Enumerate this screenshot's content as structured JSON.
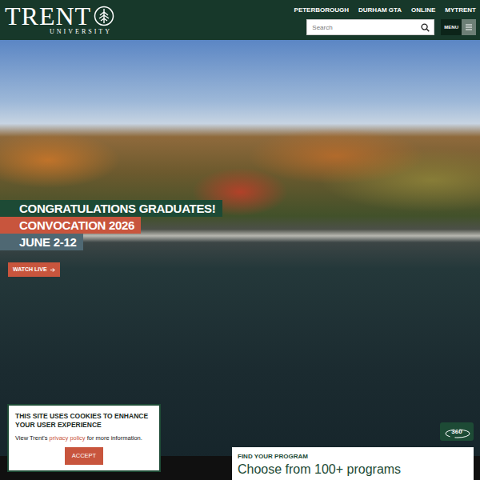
{
  "logo": {
    "name": "TRENT",
    "subtitle": "UNIVERSITY"
  },
  "top_links": [
    "PETERBOROUGH",
    "DURHAM GTA",
    "ONLINE",
    "MYTRENT"
  ],
  "search": {
    "placeholder": "Search"
  },
  "menu_button": "MENU",
  "hero": {
    "lines": [
      {
        "text": "CONGRATULATIONS GRADUATES!",
        "color": "#1d4a35"
      },
      {
        "text": "CONVOCATION 2026",
        "color": "#c8553d"
      },
      {
        "text": "JUNE 2-12",
        "color": "#4f6873"
      }
    ],
    "button": "WATCH LIVE"
  },
  "cookie_notice": {
    "title": "THIS SITE USES COOKIES TO ENHANCE YOUR USER EXPERIENCE",
    "text_before": "View Trent's ",
    "link": "privacy policy",
    "text_after": " for more information.",
    "button": "ACCEPT"
  },
  "tour_badge": "360",
  "program_card": {
    "label": "FIND YOUR PROGRAM",
    "title": "Choose from 100+ programs"
  }
}
